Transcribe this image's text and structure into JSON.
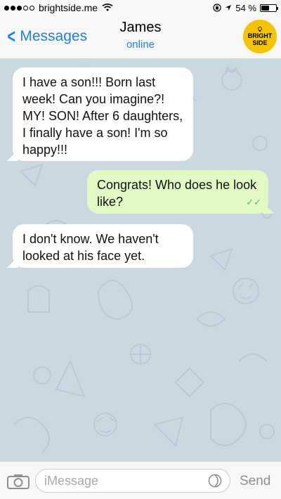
{
  "status_bar": {
    "carrier": "brightside.me",
    "battery_percent": "54 %",
    "battery_level": 0.54
  },
  "nav": {
    "back_label": "Messages",
    "contact_name": "James",
    "contact_status": "online",
    "logo_text_line1": "BRIGHT",
    "logo_text_line2": "SIDE"
  },
  "messages": [
    {
      "direction": "incoming",
      "text": "I have a son!!! Born last week! Can you imagine?! MY! SON! After 6 daughters, I finally have a son! I'm so happy!!!"
    },
    {
      "direction": "outgoing",
      "text": "Congrats! Who does he look like?",
      "status": "read"
    },
    {
      "direction": "incoming",
      "text": "I don't know. We haven't looked at his face yet."
    }
  ],
  "composer": {
    "placeholder": "iMessage",
    "value": "",
    "send_label": "Send"
  },
  "icons": {
    "back": "chevron-left-icon",
    "wifi": "wifi-icon",
    "location": "location-arrow-icon",
    "lock": "rotation-lock-icon",
    "camera": "camera-icon",
    "sticker": "sticker-icon",
    "checks": "double-check-icon"
  },
  "colors": {
    "accent": "#1d7fe8",
    "incoming_bubble": "#ffffff",
    "outgoing_bubble": "#e1fac4",
    "chat_background": "#cad8e2",
    "logo": "#f5c400"
  }
}
